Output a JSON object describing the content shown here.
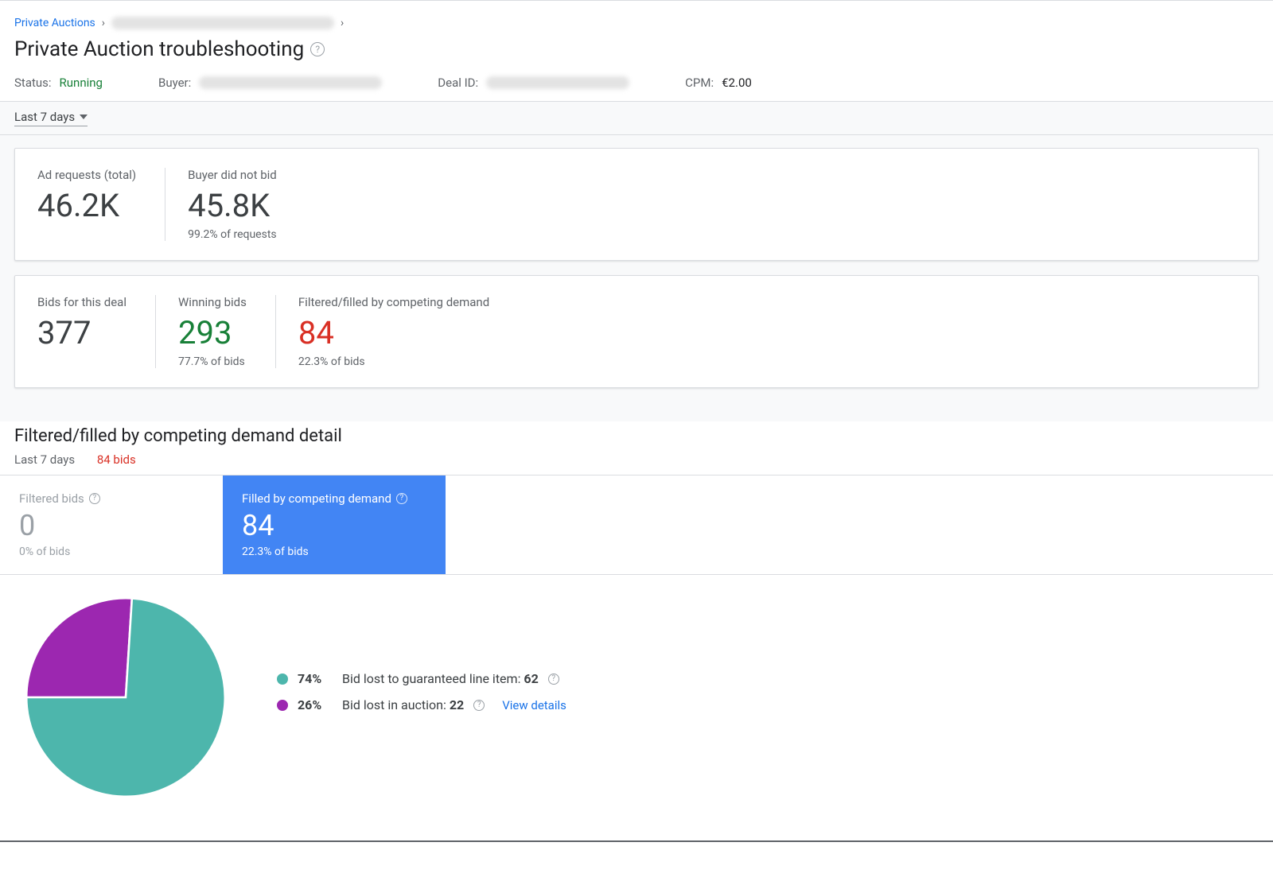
{
  "breadcrumb": {
    "root": "Private Auctions"
  },
  "title": "Private Auction troubleshooting",
  "meta": {
    "status_label": "Status:",
    "status_value": "Running",
    "buyer_label": "Buyer:",
    "dealid_label": "Deal ID:",
    "cpm_label": "CPM:",
    "cpm_value": "€2.00"
  },
  "range": "Last 7 days",
  "cards": {
    "requests": {
      "ad_requests_label": "Ad requests (total)",
      "ad_requests_value": "46.2K",
      "no_bid_label": "Buyer did not bid",
      "no_bid_value": "45.8K",
      "no_bid_sub": "99.2% of requests"
    },
    "bids": {
      "bids_label": "Bids for this deal",
      "bids_value": "377",
      "winning_label": "Winning bids",
      "winning_value": "293",
      "winning_sub": "77.7% of bids",
      "filtered_label": "Filtered/filled by competing demand",
      "filtered_value": "84",
      "filtered_sub": "22.3% of bids"
    }
  },
  "detail": {
    "heading": "Filtered/filled by competing demand detail",
    "range": "Last 7 days",
    "count": "84 bids",
    "tabs": {
      "filtered_label": "Filtered bids",
      "filtered_value": "0",
      "filtered_sub": "0% of bids",
      "competing_label": "Filled by competing demand",
      "competing_value": "84",
      "competing_sub": "22.3% of bids"
    }
  },
  "chart_data": {
    "type": "pie",
    "series": [
      {
        "name": "Bid lost to guaranteed line item",
        "percent": 74,
        "count": 62,
        "color": "#4db6ac"
      },
      {
        "name": "Bid lost in auction",
        "percent": 26,
        "count": 22,
        "color": "#9c27b0"
      }
    ]
  },
  "legend": {
    "row1_pct": "74%",
    "row1_text": "Bid lost to guaranteed line item: ",
    "row1_cnt": "62",
    "row2_pct": "26%",
    "row2_text": "Bid lost in auction: ",
    "row2_cnt": "22",
    "view_details": "View details"
  }
}
